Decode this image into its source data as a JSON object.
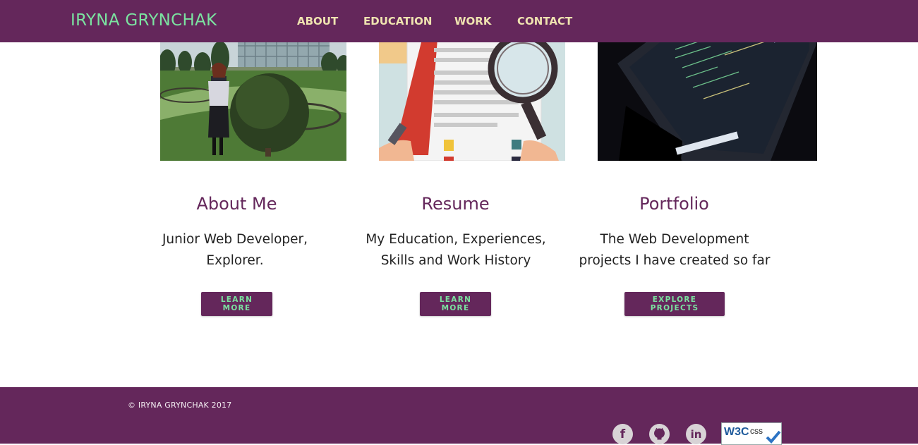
{
  "header": {
    "brand": "IRYNA GRYNCHAK",
    "nav": [
      "ABOUT",
      "EDUCATION",
      "WORK",
      "CONTACT"
    ]
  },
  "cards": [
    {
      "title": "About Me",
      "desc_line1": "Junior Web Developer,",
      "desc_line2": "Explorer.",
      "button": "LEARN MORE"
    },
    {
      "title": "Resume",
      "desc_line1": "My Education, Experiences,",
      "desc_line2": "Skills and Work History",
      "button": "LEARN MORE"
    },
    {
      "title": "Portfolio",
      "desc_line1": "The Web Development",
      "desc_line2": "projects I have created so far",
      "button": "EXPLORE PROJECTS"
    }
  ],
  "footer": {
    "copyright": "© IRYNA GRYNCHAK 2017",
    "social": [
      "facebook-icon",
      "github-icon",
      "linkedin-icon"
    ],
    "badge_text": "W3C",
    "badge_sub": "css"
  },
  "colors": {
    "brand_purple": "#64275b",
    "brand_green": "#7be3a0",
    "nav_text": "#efe3b0"
  }
}
